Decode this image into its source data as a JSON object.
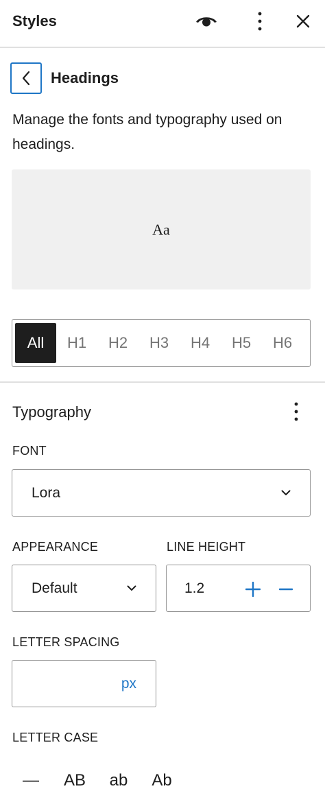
{
  "header": {
    "title": "Styles",
    "preview_icon": "eye-icon",
    "more_icon": "more-vertical-icon",
    "close_icon": "close-icon"
  },
  "nav": {
    "back_icon": "chevron-left-icon",
    "title": "Headings"
  },
  "description": "Manage the fonts and typography used on headings.",
  "preview": {
    "text": "Aa"
  },
  "levels": {
    "options": [
      "All",
      "H1",
      "H2",
      "H3",
      "H4",
      "H5",
      "H6"
    ],
    "selected": "All"
  },
  "typography": {
    "title": "Typography",
    "more_icon": "more-vertical-icon",
    "font": {
      "label": "FONT",
      "value": "Lora",
      "icon": "chevron-down-icon"
    },
    "appearance": {
      "label": "APPEARANCE",
      "value": "Default",
      "icon": "chevron-down-icon"
    },
    "line_height": {
      "label": "LINE HEIGHT",
      "value": "1.2",
      "increment_icon": "plus-icon",
      "decrement_icon": "minus-icon"
    },
    "letter_spacing": {
      "label": "LETTER SPACING",
      "value": "",
      "unit": "px"
    },
    "letter_case": {
      "label": "LETTER CASE",
      "options": [
        "—",
        "AB",
        "ab",
        "Ab"
      ]
    }
  },
  "colors": {
    "accent": "#1e76c6",
    "text": "#1e1e1e",
    "muted": "#757575",
    "border": "#949494",
    "preview_bg": "#f0f0f0"
  }
}
